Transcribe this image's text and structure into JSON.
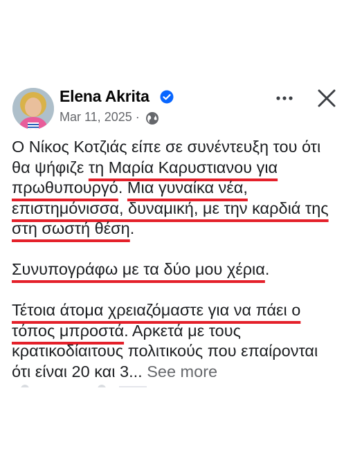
{
  "post": {
    "author": "Elena Akrita",
    "date": "Mar 11, 2025",
    "separator": "·",
    "paragraphs": [
      [
        {
          "t": "Ο Νίκος Κοτζιάς είπε σε συνέντευξη του ότι θα ψήφιζε ",
          "hl": false
        },
        {
          "t": "τη Μαρία Καρυστιανου για πρωθυπουργό",
          "hl": true
        },
        {
          "t": ". ",
          "hl": false
        },
        {
          "t": "Μια γυναίκα νέα, επιστημόνισσα, δυναμική, με την καρδιά της στη σωστή θέση",
          "hl": true
        },
        {
          "t": ".",
          "hl": false
        }
      ],
      [
        {
          "t": "Συνυπογράφω με τα δύο μου χέρια",
          "hl": true
        },
        {
          "t": ".",
          "hl": false
        }
      ],
      [
        {
          "t": "Τέτοια άτομα χρειαζόμαστε για να πάει ο τόπος μπροστά",
          "hl": true
        },
        {
          "t": ". Αρκετά με τους κρατικοδίαιτους πολιτικούς που επαίρονται ότι είναι 20 και 3... ",
          "hl": false
        }
      ]
    ],
    "see_more": "See more"
  },
  "colors": {
    "underline": "#e4202a",
    "verified_blue": "#0866ff",
    "text": "#1c1e21",
    "muted": "#65676b"
  },
  "icons": {
    "verified": "verified-badge-icon",
    "globe": "globe-icon",
    "more": "more-options-icon",
    "close": "close-icon"
  }
}
